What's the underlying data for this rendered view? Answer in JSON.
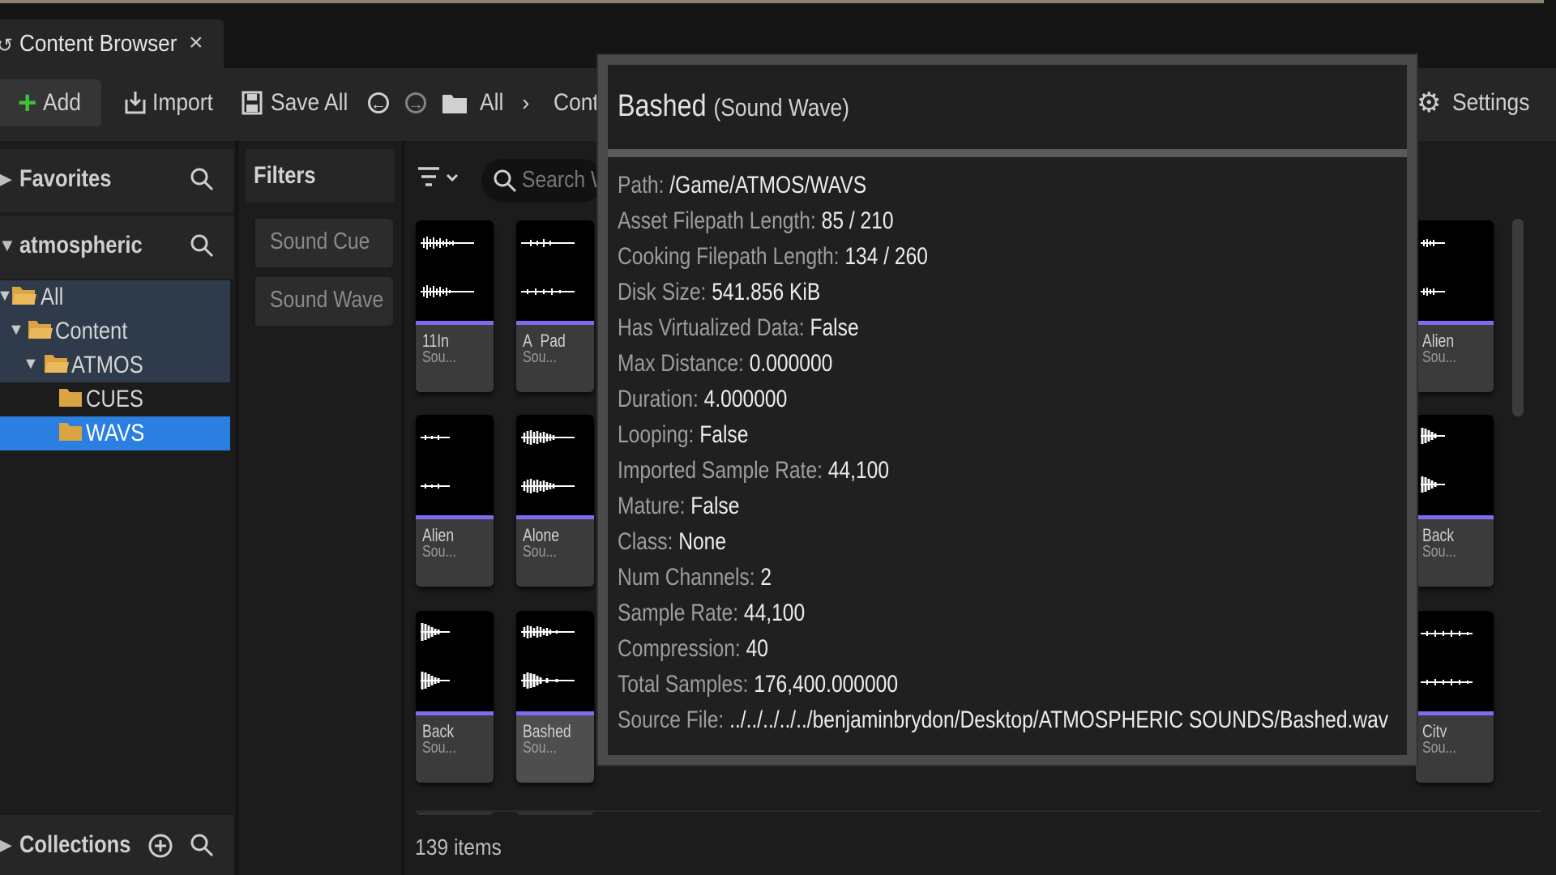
{
  "tab": {
    "title": "Content Browser",
    "close": "×"
  },
  "toolbar": {
    "add": "Add",
    "import": "Import",
    "save_all": "Save All",
    "path_all": "All",
    "path_content": "Content",
    "settings": "Settings"
  },
  "sidebar": {
    "favorites": "Favorites",
    "project": "atmospheric",
    "tree": [
      {
        "label": "All",
        "depth": 0,
        "expanded": true
      },
      {
        "label": "Content",
        "depth": 1,
        "expanded": true
      },
      {
        "label": "ATMOS",
        "depth": 2,
        "expanded": true
      },
      {
        "label": "CUES",
        "depth": 3
      },
      {
        "label": "WAVS",
        "depth": 3,
        "selected": true
      }
    ],
    "collections": "Collections"
  },
  "filters": {
    "title": "Filters",
    "items": [
      "Sound Cue",
      "Sound Wave"
    ]
  },
  "search": {
    "placeholder": "Search WAVS"
  },
  "assets": [
    {
      "name": "11In",
      "type": "Sou..."
    },
    {
      "name": "A_Pad",
      "type": "Sou..."
    },
    {
      "name": "Alien",
      "type": "Sou..."
    },
    {
      "name": "Alien",
      "type": "Sou..."
    },
    {
      "name": "Alone",
      "type": "Sou..."
    },
    {
      "name": "Back",
      "type": "Sou..."
    },
    {
      "name": "Back",
      "type": "Sou..."
    },
    {
      "name": "Bashed",
      "type": "Sou...",
      "selected": true
    },
    {
      "name": "City",
      "type": "Sou..."
    }
  ],
  "status": {
    "count": "139 items"
  },
  "tooltip": {
    "title": "Bashed",
    "subtitle": "(Sound Wave)",
    "props": [
      {
        "k": "Path:",
        "v": "/Game/ATMOS/WAVS"
      },
      {
        "k": "Asset Filepath Length:",
        "v": "85 / 210"
      },
      {
        "k": "Cooking Filepath Length:",
        "v": "134 / 260"
      },
      {
        "k": "Disk Size:",
        "v": "541.856 KiB"
      },
      {
        "k": "Has Virtualized Data:",
        "v": "False"
      },
      {
        "k": "Max Distance:",
        "v": "0.000000"
      },
      {
        "k": "Duration:",
        "v": "4.000000"
      },
      {
        "k": "Looping:",
        "v": "False"
      },
      {
        "k": "Imported Sample Rate:",
        "v": "44,100"
      },
      {
        "k": "Mature:",
        "v": "False"
      },
      {
        "k": "Class:",
        "v": "None"
      },
      {
        "k": "Num Channels:",
        "v": "2"
      },
      {
        "k": "Sample Rate:",
        "v": "44,100"
      },
      {
        "k": "Compression:",
        "v": "40"
      },
      {
        "k": "Total Samples:",
        "v": "176,400.000000"
      },
      {
        "k": "Source File:",
        "v": "../../../../../benjaminbrydon/Desktop/ATMOSPHERIC SOUNDS/Bashed.wav"
      }
    ]
  },
  "colors": {
    "accent": "#2b7fe0",
    "sound_bar": "#7b6cf0",
    "add_green": "#3ec23a",
    "folder": "#d9a441"
  }
}
